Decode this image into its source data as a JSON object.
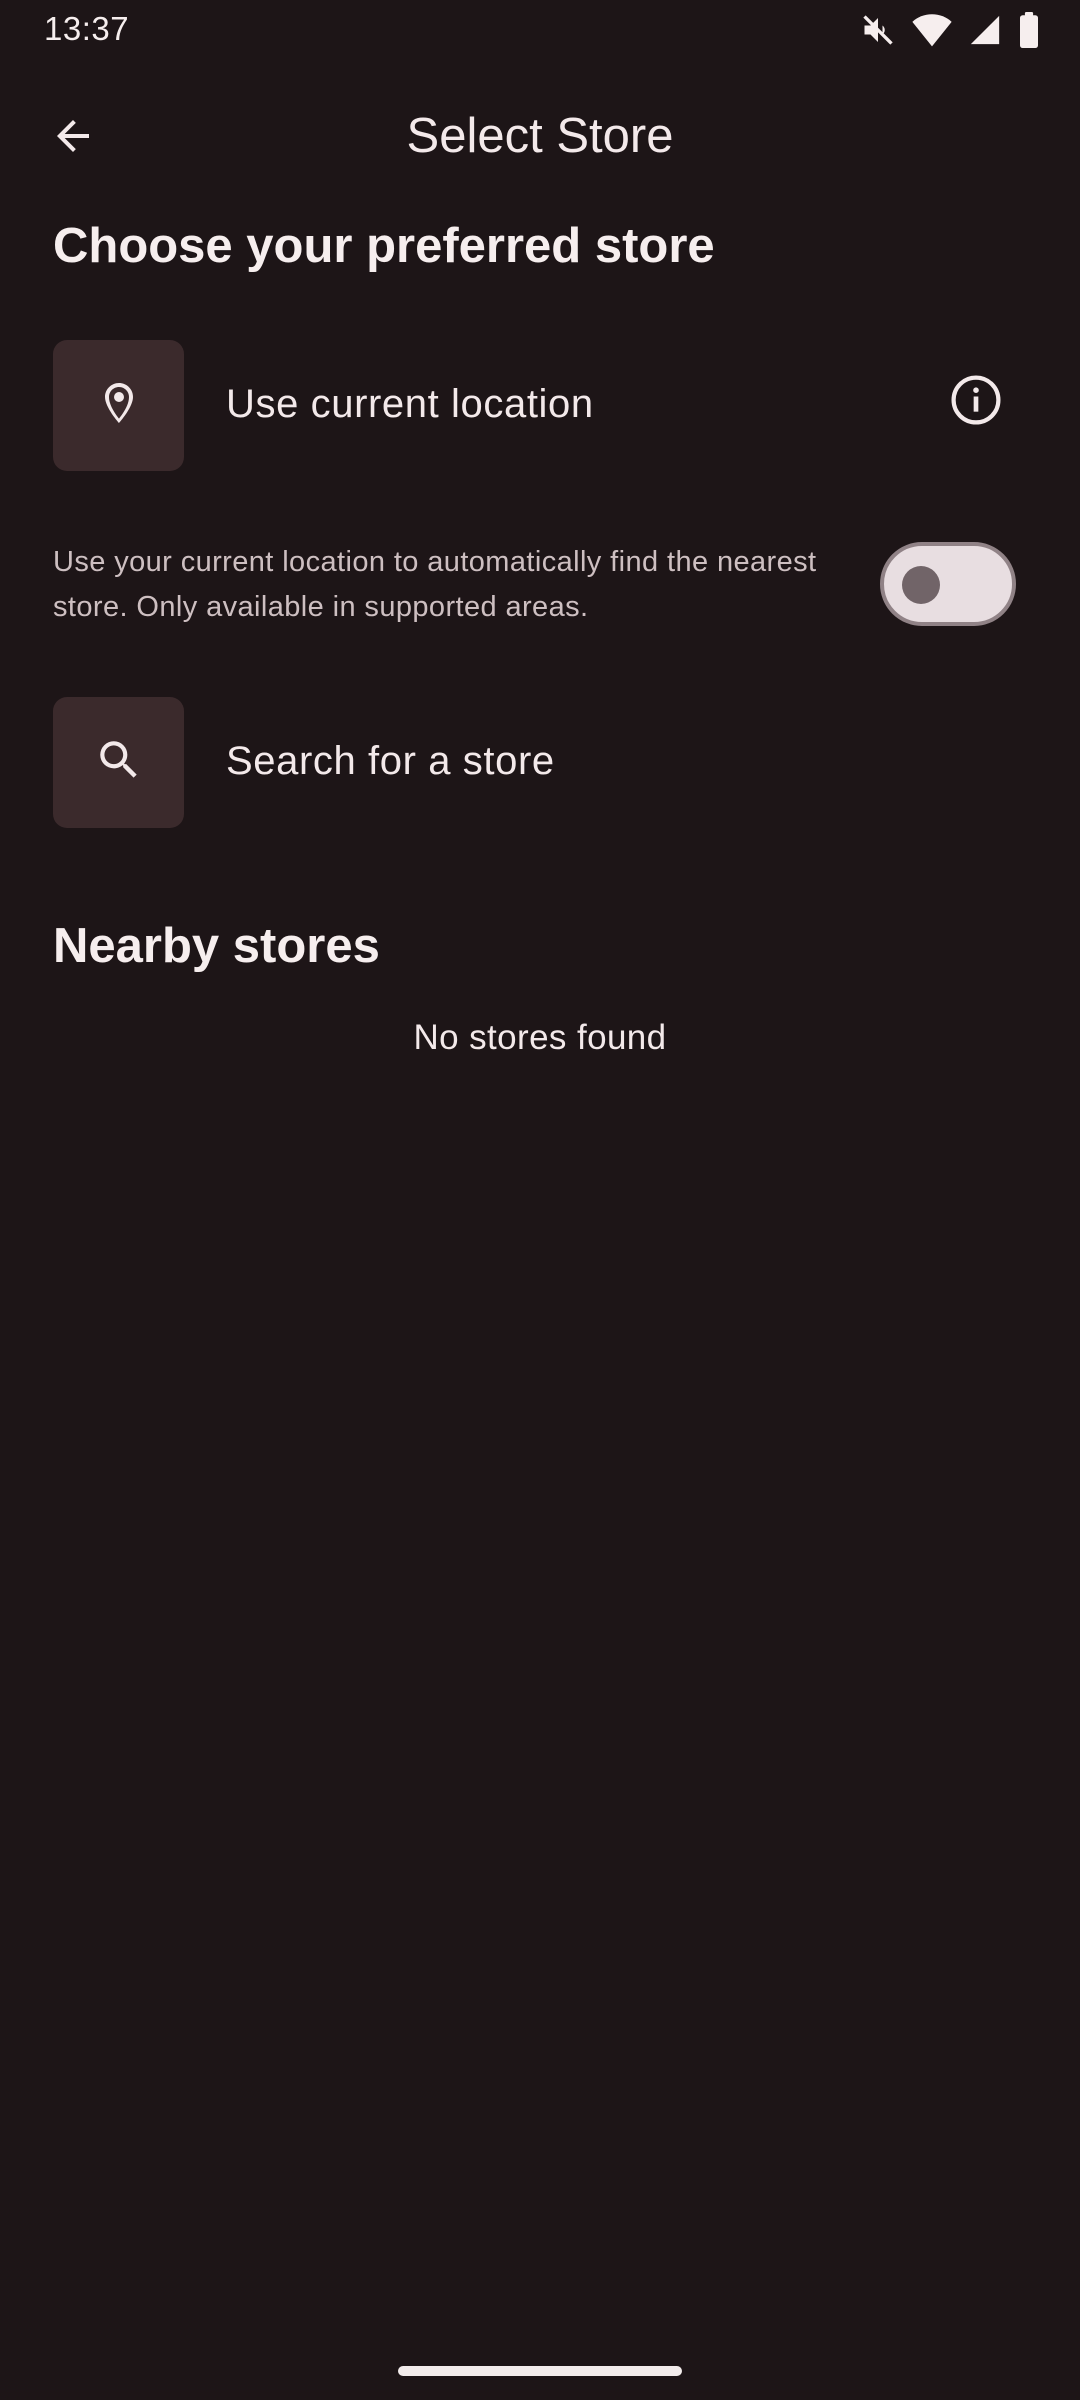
{
  "status_bar": {
    "time": "13:37",
    "icons": [
      "mute-icon",
      "wifi-icon",
      "signal-icon",
      "battery-icon"
    ]
  },
  "app_bar": {
    "back_icon": "arrow-back-icon",
    "title": "Select Store"
  },
  "choose_section": {
    "heading": "Choose your preferred store"
  },
  "location_option": {
    "icon": "location-pin-icon",
    "label": "Use current location",
    "info_icon": "info-icon",
    "description": "Use your current location to automatically find the nearest store. Only available in supported areas.",
    "toggle_on": false
  },
  "search_option": {
    "icon": "search-icon",
    "label": "Search for a store"
  },
  "nearby_section": {
    "heading": "Nearby stores",
    "empty_message": "No stores found"
  },
  "colors": {
    "background": "#1d1517",
    "tile": "#3b2a2c",
    "text": "#f3e9ea",
    "secondary_text": "#cdbfc1",
    "toggle_track": "#e8dee1",
    "toggle_knob": "#716468"
  }
}
